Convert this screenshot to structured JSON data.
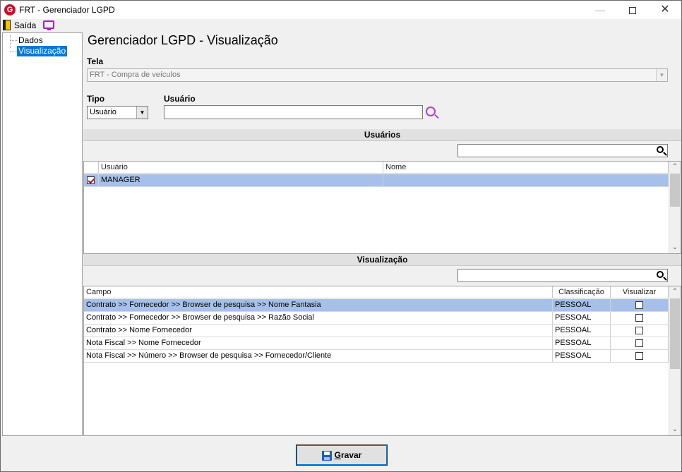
{
  "window": {
    "title": "FRT - Gerenciador LGPD"
  },
  "menu": {
    "exit_label": "Saída"
  },
  "tree": {
    "items": [
      "Dados",
      "Visualização"
    ],
    "selected": 1
  },
  "page": {
    "title": "Gerenciador LGPD - Visualização"
  },
  "tela": {
    "label": "Tela",
    "value": "FRT - Compra de veículos"
  },
  "tipo": {
    "label": "Tipo",
    "value": "Usuário"
  },
  "usuario_field": {
    "label": "Usuário",
    "value": ""
  },
  "usuarios_section": {
    "title": "Usuários",
    "columns": [
      "Usuário",
      "Nome"
    ],
    "rows": [
      {
        "checked": true,
        "usuario": "MANAGER",
        "nome": ""
      }
    ]
  },
  "visualizacao_section": {
    "title": "Visualização",
    "columns": [
      "Campo",
      "Classificação",
      "Visualizar"
    ],
    "rows": [
      {
        "campo": "Contrato >> Fornecedor >> Browser de pesquisa >> Nome Fantasia",
        "classificacao": "PESSOAL",
        "visualizar": false
      },
      {
        "campo": "Contrato >> Fornecedor >> Browser de pesquisa >> Razão Social",
        "classificacao": "PESSOAL",
        "visualizar": false
      },
      {
        "campo": "Contrato >> Nome Fornecedor",
        "classificacao": "PESSOAL",
        "visualizar": false
      },
      {
        "campo": "Nota Fiscal  >> Nome Fornecedor",
        "classificacao": "PESSOAL",
        "visualizar": false
      },
      {
        "campo": "Nota Fiscal >> Número  >> Browser de pesquisa >> Fornecedor/Cliente",
        "classificacao": "PESSOAL",
        "visualizar": false
      }
    ]
  },
  "save_button": {
    "label_first": "G",
    "label_rest": "ravar"
  },
  "colors": {
    "selection": "#0078d7",
    "row_highlight": "#a6c0ea",
    "accent_icon": "#b040d0"
  }
}
